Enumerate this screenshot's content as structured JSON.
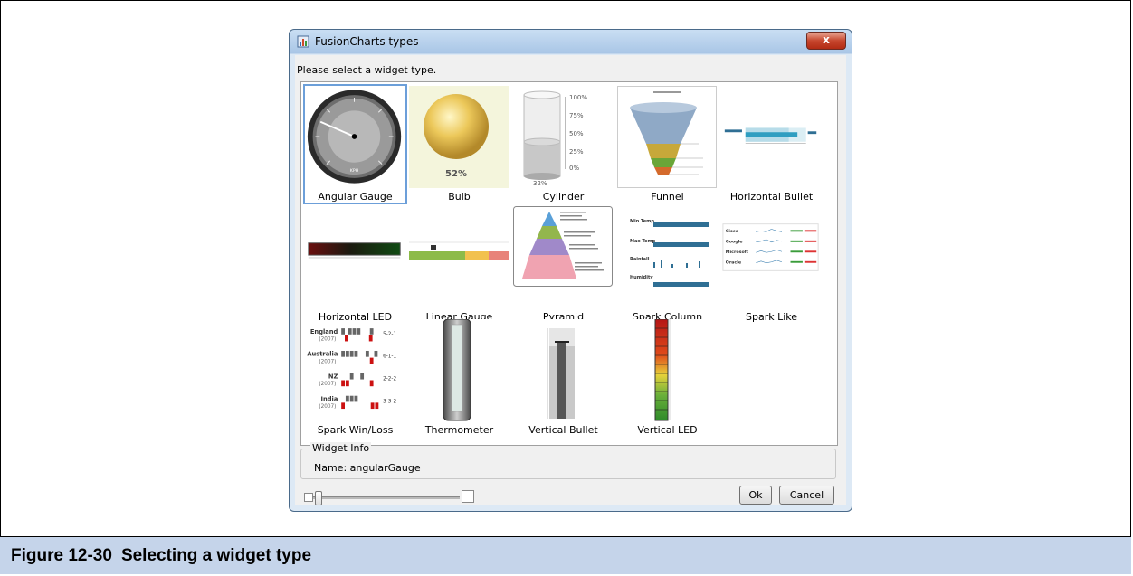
{
  "dialog": {
    "title": "FusionCharts types",
    "close_label": "x",
    "prompt": "Please select a widget type.",
    "ok_label": "Ok",
    "cancel_label": "Cancel"
  },
  "widgets": [
    {
      "label": "Angular Gauge",
      "selected": true
    },
    {
      "label": "Bulb"
    },
    {
      "label": "Cylinder"
    },
    {
      "label": "Funnel"
    },
    {
      "label": "Horizontal Bullet"
    },
    {
      "label": "Horizontal LED"
    },
    {
      "label": "Linear Gauge"
    },
    {
      "label": "Pyramid"
    },
    {
      "label": "Spark Column"
    },
    {
      "label": "Spark Like"
    },
    {
      "label": "Spark Win/Loss"
    },
    {
      "label": "Thermometer"
    },
    {
      "label": "Vertical Bullet"
    },
    {
      "label": "Vertical LED"
    }
  ],
  "thumbs": {
    "bulb_value": "52%",
    "cylinder_ticks": [
      "100%",
      "75%",
      "50%",
      "25%",
      "0%"
    ],
    "cylinder_value": "32%",
    "gauge_unit": "KPH",
    "spark_column_rows": [
      "Min Temp",
      "Max Temp",
      "Rainfall",
      "Humidity"
    ],
    "spark_like_rows": [
      "Cisco",
      "Google",
      "Microsoft",
      "Oracle"
    ],
    "winloss_rows": [
      {
        "team": "England",
        "year": "(2007)",
        "score": "5-2-1"
      },
      {
        "team": "Australia",
        "year": "(2007)",
        "score": "6-1-1"
      },
      {
        "team": "NZ",
        "year": "(2007)",
        "score": "2-2-2"
      },
      {
        "team": "India",
        "year": "(2007)",
        "score": "3-3-2"
      }
    ]
  },
  "info": {
    "legend": "Widget Info",
    "name_text": "Name:  angularGauge"
  },
  "caption": {
    "number": "Figure 12-30",
    "text": "Selecting a widget type"
  }
}
